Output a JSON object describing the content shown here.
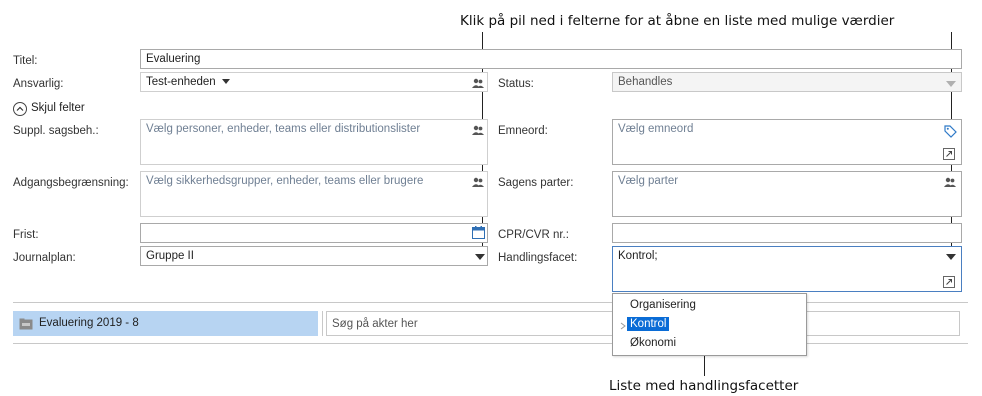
{
  "callouts": {
    "top": "Klik på pil ned i felterne for at åbne en liste med mulige værdier",
    "bottom": "Liste med handlingsfacetter"
  },
  "form": {
    "title_label": "Titel:",
    "title_value": "Evaluering",
    "responsible_label": "Ansvarlig:",
    "responsible_value": "Test-enheden",
    "status_label": "Status:",
    "status_value": "Behandles",
    "hide_fields": "Skjul felter",
    "suppl_label": "Suppl. sagsbeh.:",
    "suppl_placeholder": "Vælg personer, enheder, teams eller distributionslister",
    "keyword_label": "Emneord:",
    "keyword_placeholder": "Vælg emneord",
    "access_label": "Adgangsbegrænsning:",
    "access_placeholder": "Vælg sikkerhedsgrupper, enheder, teams eller brugere",
    "parties_label": "Sagens parter:",
    "parties_placeholder": "Vælg parter",
    "deadline_label": "Frist:",
    "deadline_value": "",
    "cpr_label": "CPR/CVR nr.:",
    "cpr_value": "",
    "journal_label": "Journalplan:",
    "journal_value": "Gruppe II",
    "facet_label": "Handlingsfacet:",
    "facet_value": "Kontrol;"
  },
  "dropdown": {
    "options": [
      "Organisering",
      "Kontrol",
      "Økonomi"
    ],
    "selected_index": 1
  },
  "bottom_bar": {
    "case_tab": "Evaluering 2019 - 8",
    "search_placeholder": "Søg på akter her"
  },
  "colors": {
    "selected_bg": "#0a6cd6",
    "tab_bg": "#b7d4f2",
    "placeholder": "#6f7f93"
  }
}
